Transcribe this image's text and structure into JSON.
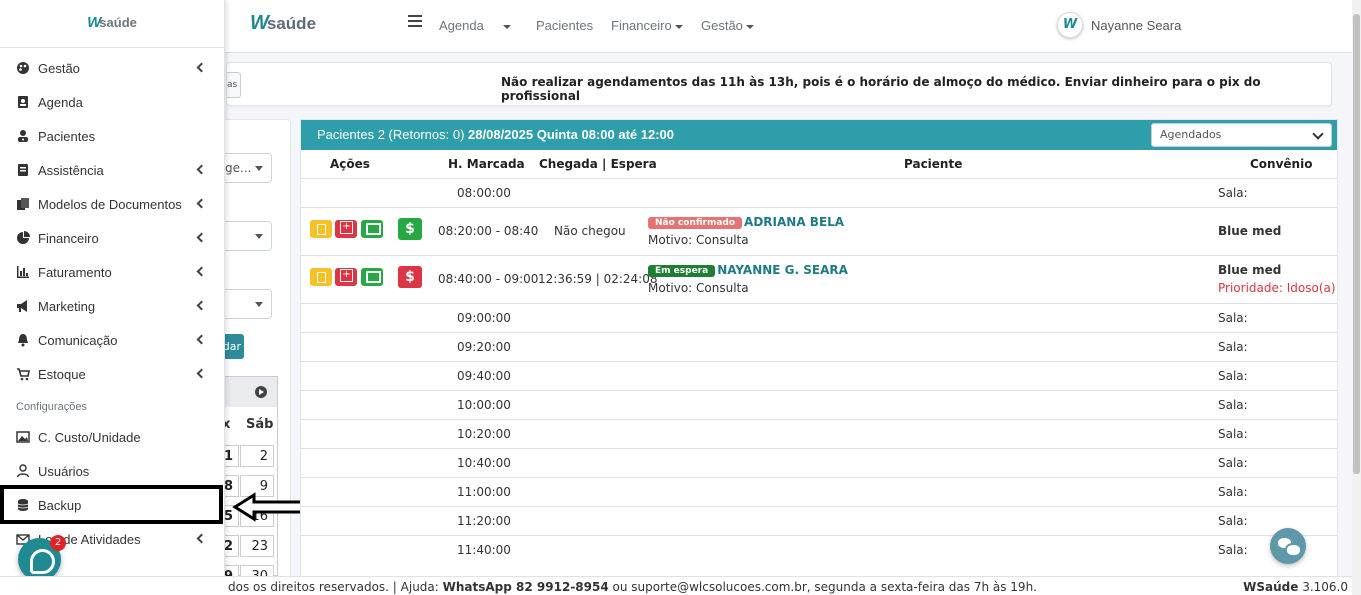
{
  "navbar": {
    "brand_w": "W",
    "brand_text": "saúde",
    "menu": [
      "Agenda",
      "Pacientes",
      "Financeiro",
      "Gestão"
    ],
    "user_initial": "W",
    "user_name": "Nayanne Seara"
  },
  "notice": {
    "text": "Não realizar agendamentos das 11h às 13h, pois é o horário de almoço do médico. Enviar dinheiro para o pix do profissional",
    "button_fragment": "as"
  },
  "filters": {
    "select1": "ge...",
    "button_fragment": "dar"
  },
  "calendar": {
    "dow": [
      "x",
      "Sáb"
    ],
    "rows": [
      [
        "1",
        "2"
      ],
      [
        "8",
        "9"
      ],
      [
        "5",
        "16"
      ],
      [
        "22",
        "23"
      ],
      [
        "29",
        "30"
      ]
    ]
  },
  "sidebar": {
    "brand_w": "W",
    "brand_text": "saúde",
    "items": [
      {
        "label": "Gestão",
        "icon": "palette-icon",
        "submenu": true
      },
      {
        "label": "Agenda",
        "icon": "contact-book-icon",
        "submenu": false
      },
      {
        "label": "Pacientes",
        "icon": "user-doctor-icon",
        "submenu": false
      },
      {
        "label": "Assistência",
        "icon": "notebook-icon",
        "submenu": true
      },
      {
        "label": "Modelos de Documentos",
        "icon": "documents-icon",
        "submenu": true
      },
      {
        "label": "Financeiro",
        "icon": "pie-chart-icon",
        "submenu": true
      },
      {
        "label": "Faturamento",
        "icon": "bar-chart-icon",
        "submenu": true
      },
      {
        "label": "Marketing",
        "icon": "megaphone-icon",
        "submenu": true
      },
      {
        "label": "Comunicação",
        "icon": "bell-icon",
        "submenu": true
      },
      {
        "label": "Estoque",
        "icon": "cart-icon",
        "submenu": true
      }
    ],
    "config_header": "Configurações",
    "config_items": [
      {
        "label": "C. Custo/Unidade",
        "icon": "image-icon",
        "submenu": false
      },
      {
        "label": "Usuários",
        "icon": "user-icon",
        "submenu": false
      },
      {
        "label": "Backup",
        "icon": "database-icon",
        "submenu": false
      },
      {
        "label": "Log de Atividades",
        "icon": "envelope-icon",
        "submenu": true
      }
    ]
  },
  "chat": {
    "badge": "2"
  },
  "schedule": {
    "title": "Pacientes 2 (Retornos: 0)",
    "title_bold": "28/08/2025 Quinta 08:00 até 12:00",
    "filter_value": "Agendados",
    "headers": [
      "Ações",
      "H. Marcada",
      "Chegada | Espera",
      "Paciente",
      "Convênio"
    ],
    "rows": [
      {
        "time": "08:00:00",
        "sala": "Sala:"
      },
      {
        "time": "08:20:00 - 08:40",
        "arrival": "Não chegou",
        "status": "Não confirmado",
        "status_color": "#e57373",
        "payment_color": "#28a745",
        "patient": "ADRIANA BELA",
        "reason": "Motivo: Consulta",
        "insurance": "Blue med",
        "priority": ""
      },
      {
        "time": "08:40:00 - 09:00",
        "arrival": "12:36:59 | 02:24:08",
        "status": "Em espera",
        "status_color": "#1e7e34",
        "payment_color": "#dc3545",
        "patient": "NAYANNE G. SEARA",
        "reason": "Motivo: Consulta",
        "insurance": "Blue med",
        "priority": "Prioridade: Idoso(a)"
      },
      {
        "time": "09:00:00",
        "sala": "Sala:"
      },
      {
        "time": "09:20:00",
        "sala": "Sala:"
      },
      {
        "time": "09:40:00",
        "sala": "Sala:"
      },
      {
        "time": "10:00:00",
        "sala": "Sala:"
      },
      {
        "time": "10:20:00",
        "sala": "Sala:"
      },
      {
        "time": "10:40:00",
        "sala": "Sala:"
      },
      {
        "time": "11:00:00",
        "sala": "Sala:"
      },
      {
        "time": "11:20:00",
        "sala": "Sala:"
      },
      {
        "time": "11:40:00",
        "sala": "Sala:"
      }
    ]
  },
  "footer": {
    "left_prefix": "dos os direitos reservados. | Ajuda: ",
    "whatsapp": "WhatsApp 82 9912-8954",
    "left_suffix": " ou suporte@wlcsolucoes.com.br, segunda a sexta-feira das 7h às 19h.",
    "brand": "WSaúde",
    "version": " 3.106.0"
  }
}
